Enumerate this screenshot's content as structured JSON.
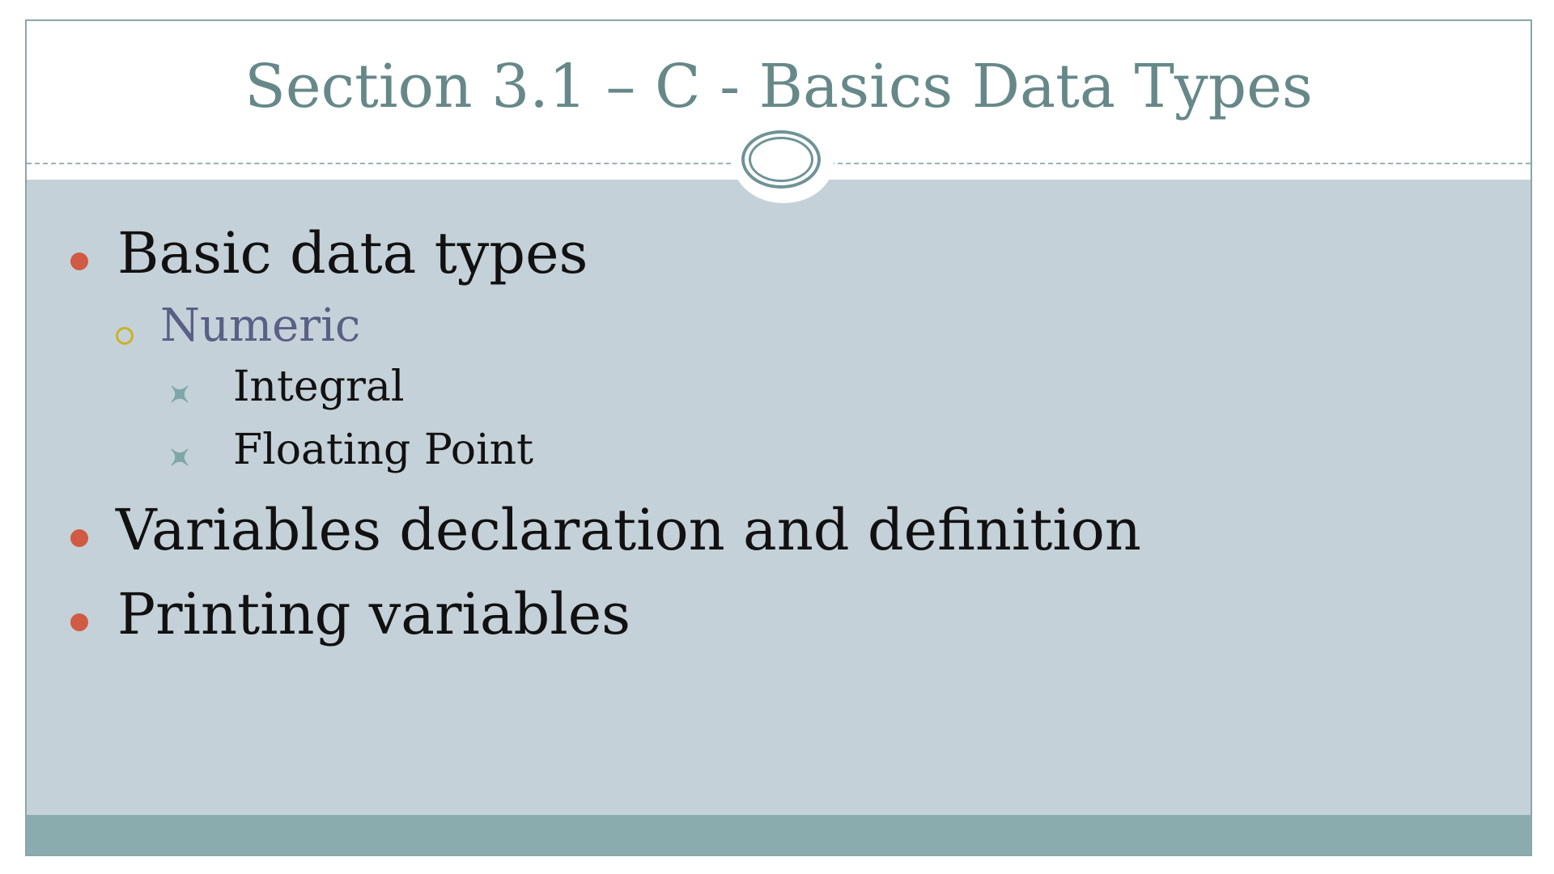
{
  "slide": {
    "title": "Section 3.1 – C - Basics Data Types",
    "bullets": [
      {
        "level": 1,
        "text": "Basic data types"
      },
      {
        "level": 2,
        "text": "Numeric"
      },
      {
        "level": 3,
        "text": "Integral"
      },
      {
        "level": 3,
        "text": "Floating Point"
      },
      {
        "level": 1,
        "text": "Variables declaration and definition"
      },
      {
        "level": 1,
        "text": "Printing variables"
      }
    ]
  },
  "theme": {
    "title_color": "#668888",
    "content_background": "#c5d1d8",
    "footer_color": "#8aacae",
    "level1_bullet_color": "#d05a44",
    "level2_bullet_color": "#c9b22a",
    "level2_text_color": "#5a5f85",
    "level3_bullet_color": "#7fa6a8",
    "level1_bullet_icon": "filled-circle",
    "level2_bullet_icon": "hollow-circle",
    "level3_bullet_icon": "four-point-star"
  }
}
